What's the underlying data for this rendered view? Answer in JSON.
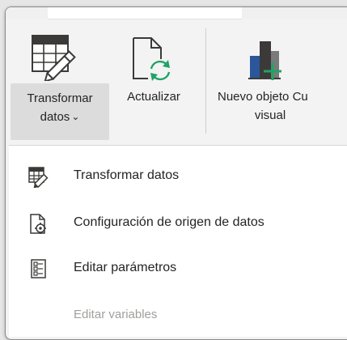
{
  "ribbon": {
    "transform_button": {
      "line1": "Transformar",
      "line2": "datos",
      "chevron": "⌄"
    },
    "refresh_button": {
      "label": "Actualizar"
    },
    "new_visual_button": {
      "line1": "Nuevo objeto Cu",
      "line2": "visual"
    }
  },
  "menu": {
    "items": [
      {
        "label": "Transformar datos",
        "icon": "transform-data-icon",
        "enabled": true
      },
      {
        "label": "Configuración de origen de datos",
        "icon": "data-source-settings-icon",
        "enabled": true
      },
      {
        "label": "Editar parámetros",
        "icon": "edit-parameters-icon",
        "enabled": true
      },
      {
        "label": "Editar variables",
        "icon": "",
        "enabled": false
      }
    ]
  },
  "colors": {
    "green_accent": "#21a366",
    "dark_icon": "#3b3a39",
    "disabled_text": "#a19f9d",
    "hover_bg": "#dcdcdc"
  }
}
